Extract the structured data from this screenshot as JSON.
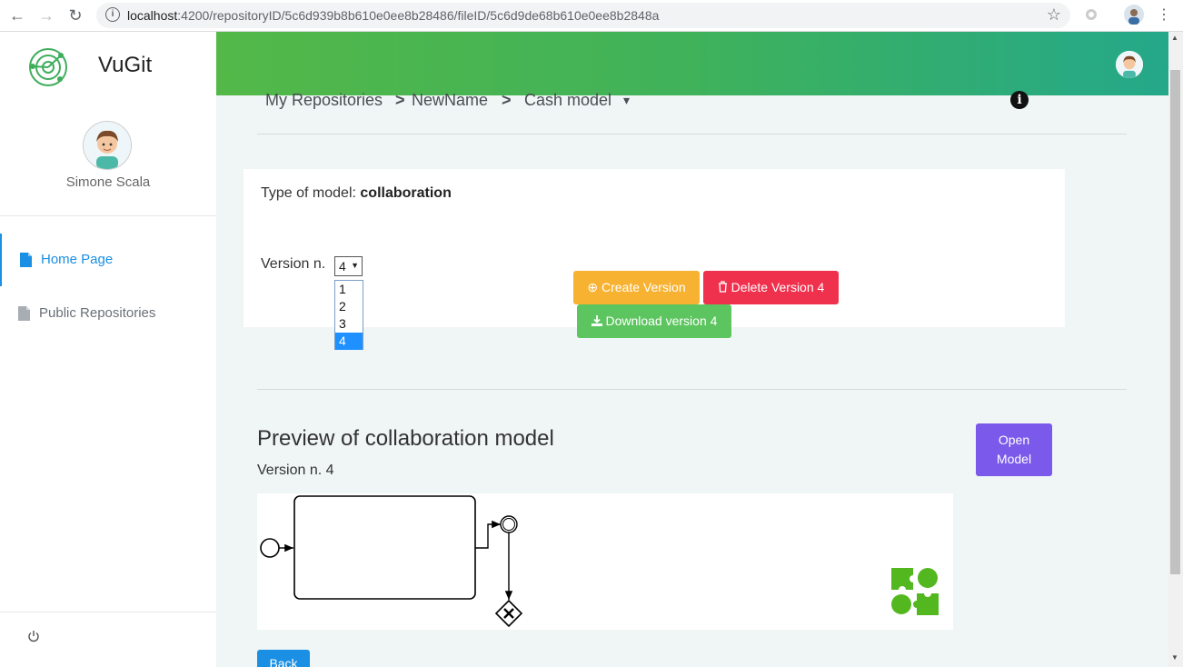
{
  "browser": {
    "url_host": "localhost",
    "url_path": ":4200/repositoryID/5c6d939b8b610e0ee8b28486/fileID/5c6d9de68b610e0ee8b2848a"
  },
  "sidebar": {
    "brand": "VuGit",
    "user_name": "Simone Scala",
    "items": [
      {
        "label": "Home Page",
        "icon": "file-icon",
        "active": true
      },
      {
        "label": "Public Repositories",
        "icon": "file-icon",
        "active": false
      }
    ],
    "logout_icon": "power-icon"
  },
  "breadcrumb": {
    "root": "My Repositories",
    "sep1": ">",
    "repo": "NewName",
    "sep2": ">",
    "file": "Cash model",
    "caret": "▾"
  },
  "model_info": {
    "type_label": "Type of model: ",
    "type_value": "collaboration",
    "version_label": "Version n.",
    "version_selected": "4",
    "version_options": [
      "1",
      "2",
      "3",
      "4"
    ]
  },
  "actions": {
    "create": "Create Version",
    "delete": "Delete Version 4",
    "download": "Download version 4"
  },
  "preview": {
    "title": "Preview of collaboration model",
    "version": "Version n. 4",
    "open_button_line1": "Open",
    "open_button_line2": "Model",
    "back_button": "Back"
  },
  "colors": {
    "header_gradient_start": "#53b848",
    "header_gradient_end": "#24a88a",
    "create": "#f8b232",
    "delete": "#f0314e",
    "download": "#5cc55f",
    "open": "#7b59ea",
    "back": "#1a8fe3",
    "active_nav": "#1a8fe3"
  }
}
